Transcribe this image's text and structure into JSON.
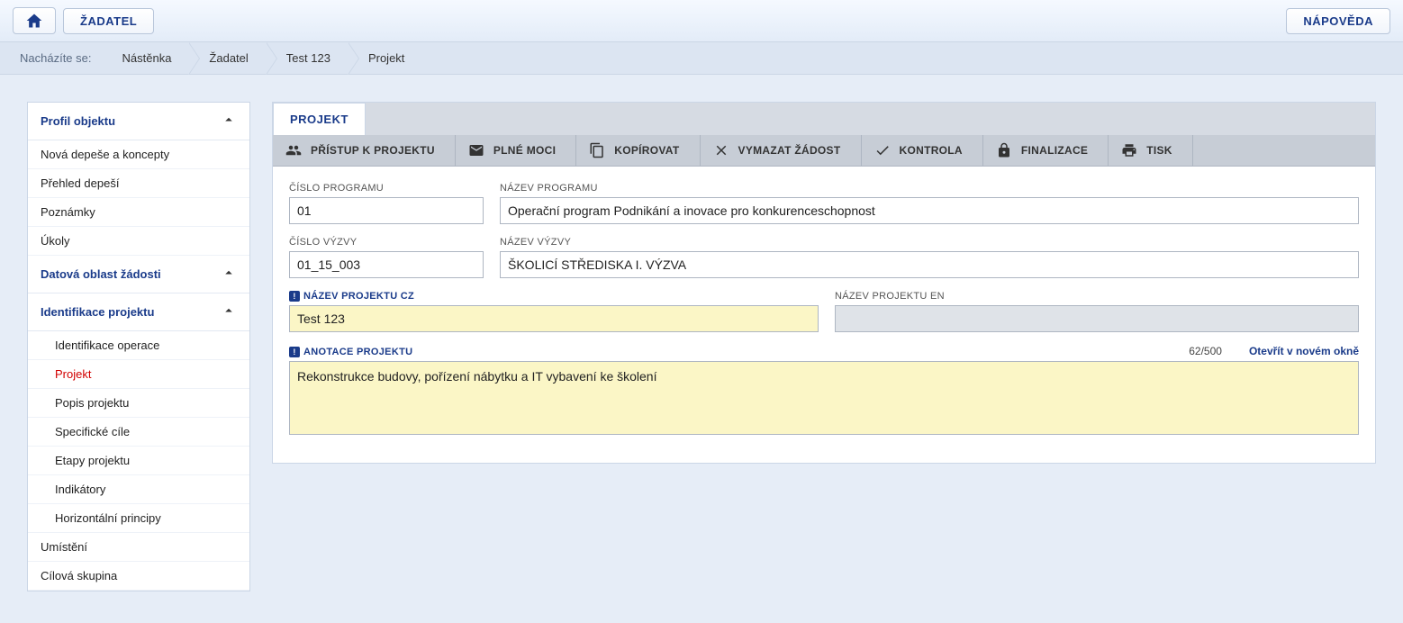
{
  "topbar": {
    "applicant_btn": "ŽADATEL",
    "help_btn": "NÁPOVĚDA"
  },
  "breadcrumb": {
    "label": "Nacházíte se:",
    "items": [
      "Nástěnka",
      "Žadatel",
      "Test 123",
      "Projekt"
    ]
  },
  "sidebar": {
    "sections": [
      {
        "title": "Profil objektu",
        "items": [
          "Nová depeše a koncepty",
          "Přehled depeší",
          "Poznámky",
          "Úkoly"
        ]
      },
      {
        "title": "Datová oblast žádosti",
        "items": []
      },
      {
        "title": "Identifikace projektu",
        "items": [
          "Identifikace operace",
          "Projekt",
          "Popis projektu",
          "Specifické cíle",
          "Etapy projektu",
          "Indikátory",
          "Horizontální principy"
        ],
        "active_index": 1
      }
    ],
    "after_items": [
      "Umístění",
      "Cílová skupina"
    ]
  },
  "content": {
    "tab_label": "PROJEKT",
    "toolbar": [
      {
        "icon": "people",
        "label": "PŘÍSTUP K PROJEKTU"
      },
      {
        "icon": "mail",
        "label": "PLNÉ MOCI"
      },
      {
        "icon": "copy",
        "label": "KOPÍROVAT"
      },
      {
        "icon": "delete",
        "label": "VYMAZAT ŽÁDOST"
      },
      {
        "icon": "check",
        "label": "KONTROLA"
      },
      {
        "icon": "lock",
        "label": "FINALIZACE"
      },
      {
        "icon": "print",
        "label": "TISK"
      }
    ],
    "fields": {
      "program_number_label": "ČÍSLO PROGRAMU",
      "program_number_value": "01",
      "program_name_label": "NÁZEV PROGRAMU",
      "program_name_value": "Operační program Podnikání a inovace pro konkurenceschopnost",
      "call_number_label": "ČÍSLO VÝZVY",
      "call_number_value": "01_15_003",
      "call_name_label": "NÁZEV VÝZVY",
      "call_name_value": "ŠKOLICÍ STŘEDISKA I. VÝZVA",
      "project_name_cz_label": "NÁZEV PROJEKTU CZ",
      "project_name_cz_value": "Test 123",
      "project_name_en_label": "NÁZEV PROJEKTU EN",
      "project_name_en_value": "",
      "annotation_label": "ANOTACE PROJEKTU",
      "annotation_value": "Rekonstrukce budovy, pořízení nábytku a IT vybavení ke školení",
      "annotation_counter": "62/500",
      "open_new_window": "Otevřít v novém okně"
    }
  }
}
